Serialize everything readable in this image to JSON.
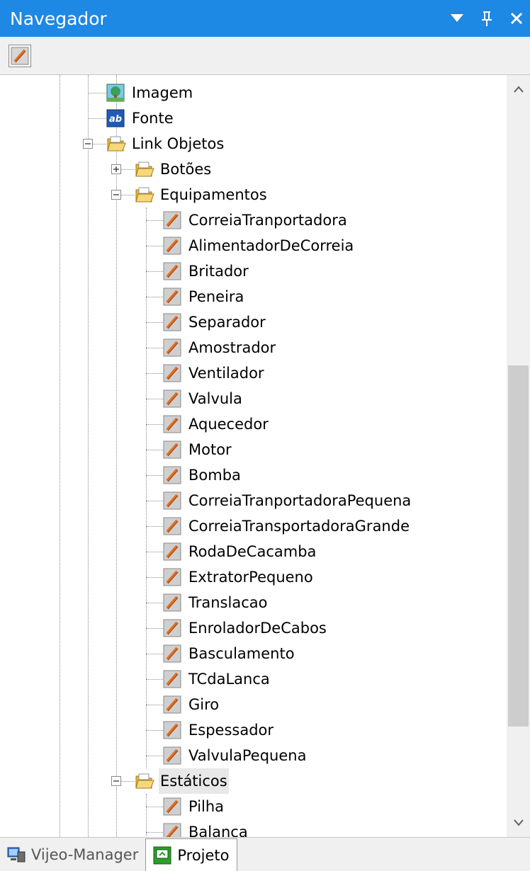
{
  "window": {
    "title": "Navegador",
    "buttons": {
      "dropdown": "▼",
      "pin": "📌",
      "close": "✕"
    }
  },
  "toolbar": {
    "icon": "object-link-icon"
  },
  "tree": {
    "items": [
      {
        "label": "Imagem",
        "icon": "image-icon",
        "level": 1
      },
      {
        "label": "Fonte",
        "icon": "font-icon",
        "level": 1
      },
      {
        "label": "Link Objetos",
        "icon": "folder-icon",
        "level": 1,
        "expanded": true
      },
      {
        "label": "Botões",
        "icon": "folder-icon",
        "level": 2,
        "expanded": false
      },
      {
        "label": "Equipamentos",
        "icon": "folder-icon",
        "level": 2,
        "expanded": true
      },
      {
        "label": "CorreiaTranportadora",
        "icon": "object-link-icon",
        "level": 3
      },
      {
        "label": "AlimentadorDeCorreia",
        "icon": "object-link-icon",
        "level": 3
      },
      {
        "label": "Britador",
        "icon": "object-link-icon",
        "level": 3
      },
      {
        "label": "Peneira",
        "icon": "object-link-icon",
        "level": 3
      },
      {
        "label": "Separador",
        "icon": "object-link-icon",
        "level": 3
      },
      {
        "label": "Amostrador",
        "icon": "object-link-icon",
        "level": 3
      },
      {
        "label": "Ventilador",
        "icon": "object-link-icon",
        "level": 3
      },
      {
        "label": "Valvula",
        "icon": "object-link-icon",
        "level": 3
      },
      {
        "label": "Aquecedor",
        "icon": "object-link-icon",
        "level": 3
      },
      {
        "label": "Motor",
        "icon": "object-link-icon",
        "level": 3
      },
      {
        "label": "Bomba",
        "icon": "object-link-icon",
        "level": 3
      },
      {
        "label": "CorreiaTranportadoraPequena",
        "icon": "object-link-icon",
        "level": 3
      },
      {
        "label": "CorreiaTransportadoraGrande",
        "icon": "object-link-icon",
        "level": 3
      },
      {
        "label": "RodaDeCacamba",
        "icon": "object-link-icon",
        "level": 3
      },
      {
        "label": "ExtratorPequeno",
        "icon": "object-link-icon",
        "level": 3
      },
      {
        "label": "Translacao",
        "icon": "object-link-icon",
        "level": 3
      },
      {
        "label": "EnroladorDeCabos",
        "icon": "object-link-icon",
        "level": 3
      },
      {
        "label": "Basculamento",
        "icon": "object-link-icon",
        "level": 3
      },
      {
        "label": "TCdaLanca",
        "icon": "object-link-icon",
        "level": 3
      },
      {
        "label": "Giro",
        "icon": "object-link-icon",
        "level": 3
      },
      {
        "label": "Espessador",
        "icon": "object-link-icon",
        "level": 3
      },
      {
        "label": "ValvulaPequena",
        "icon": "object-link-icon",
        "level": 3
      },
      {
        "label": "Estáticos",
        "icon": "folder-icon",
        "level": 2,
        "expanded": true,
        "selected": true
      },
      {
        "label": "Pilha",
        "icon": "object-link-icon",
        "level": 3
      },
      {
        "label": "Balanca",
        "icon": "object-link-icon",
        "level": 3
      }
    ]
  },
  "tabs": [
    {
      "label": "Vijeo-Manager",
      "icon": "computer-icon",
      "active": false
    },
    {
      "label": "Projeto",
      "icon": "project-icon",
      "active": true
    }
  ],
  "colors": {
    "titlebar": "#1e88e5",
    "folder": "#f2c14e",
    "image_icon": "#3aa05a",
    "font_icon": "#1e5bb5",
    "object_icon_bg": "#c0c0c0",
    "object_icon_stroke": "#e07020"
  }
}
